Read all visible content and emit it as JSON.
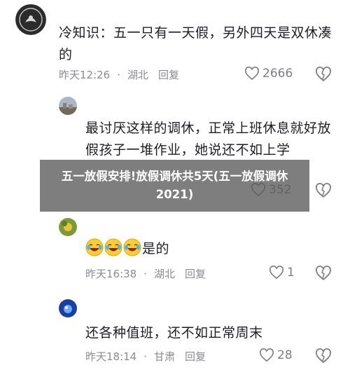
{
  "comments": [
    {
      "text": "冷知识：五一只有一天假，另外四天是双休凑的",
      "time": "昨天12:26",
      "location": "湖北",
      "reply": "回复",
      "likes": "2666"
    },
    {
      "username": "",
      "text": "最讨厌这样的调休，正常上班休息就好放假孩子一堆作业，她说还不如上学",
      "likes": "352"
    },
    {
      "username": "",
      "text": "是的",
      "time": "昨天16:38",
      "location": "湖北",
      "reply": "回复",
      "likes": "1"
    },
    {
      "text": "还各种值班，还不如正常周末",
      "time": "昨天18:14",
      "location": "甘肃",
      "reply": "回复",
      "likes": "28"
    }
  ],
  "banner": {
    "title": "五一放假安排!放假调休共5天(五一放假调休2021)"
  },
  "colors": {
    "text": "#1d1d25",
    "meta": "#8a8b91",
    "overlay": "#5a5a5a"
  },
  "icons": [
    "avatar-emblem",
    "heart-icon",
    "dislike-heart-icon",
    "laughing-emoji"
  ]
}
